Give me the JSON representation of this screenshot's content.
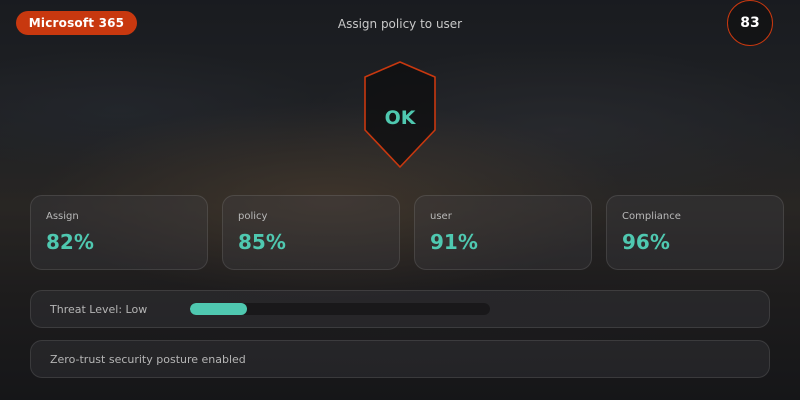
{
  "header": {
    "brand": "Microsoft 365",
    "title": "Assign policy to user",
    "score": "83"
  },
  "shield": {
    "status": "OK",
    "icon": "shield-icon",
    "stroke_color": "#c8380f"
  },
  "cards": [
    {
      "label": "Assign",
      "value": "82%"
    },
    {
      "label": "policy",
      "value": "85%"
    },
    {
      "label": "user",
      "value": "91%"
    },
    {
      "label": "Compliance",
      "value": "96%"
    }
  ],
  "threat": {
    "label": "Threat Level: Low",
    "level_fraction": 0.19
  },
  "status_message": "Zero-trust security posture enabled",
  "colors": {
    "accent": "#c8380f",
    "value": "#4fc8b0"
  }
}
